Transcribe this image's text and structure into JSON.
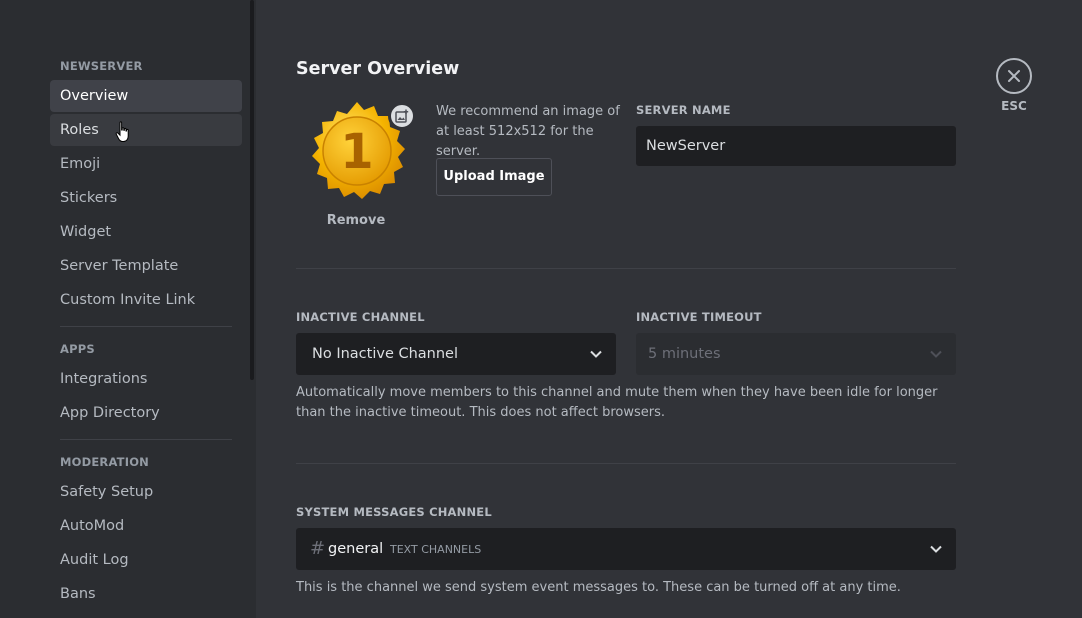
{
  "sidebar": {
    "server_header": "NEWSERVER",
    "server_items": [
      "Overview",
      "Roles",
      "Emoji",
      "Stickers",
      "Widget",
      "Server Template",
      "Custom Invite Link"
    ],
    "apps_header": "APPS",
    "apps_items": [
      "Integrations",
      "App Directory"
    ],
    "moderation_header": "MODERATION",
    "moderation_items": [
      "Safety Setup",
      "AutoMod",
      "Audit Log",
      "Bans"
    ]
  },
  "main": {
    "title": "Server Overview",
    "icon": {
      "badge_number": "1",
      "remove_label": "Remove",
      "upload_badge_icon": "add-image-icon"
    },
    "recommendation": "We recommend an image of at least 512x512 for the server.",
    "upload_button": "Upload Image",
    "server_name_label": "SERVER NAME",
    "server_name_value": "NewServer",
    "inactive_channel_label": "INACTIVE CHANNEL",
    "inactive_channel_value": "No Inactive Channel",
    "inactive_timeout_label": "INACTIVE TIMEOUT",
    "inactive_timeout_value": "5 minutes",
    "inactive_help": "Automatically move members to this channel and mute them when they have been idle for longer than the inactive timeout. This does not affect browsers.",
    "system_channel_label": "SYSTEM MESSAGES CHANNEL",
    "system_channel_hash": "#",
    "system_channel_name": "general",
    "system_channel_category": "TEXT CHANNELS",
    "system_help": "This is the channel we send system event messages to. These can be turned off at any time."
  },
  "close": {
    "label": "ESC",
    "icon": "close-icon"
  },
  "colors": {
    "background": "#313338",
    "sidebar": "#2b2d31",
    "input": "#1e1f22",
    "selected": "#404249",
    "badge_gold": "#f5b400"
  }
}
